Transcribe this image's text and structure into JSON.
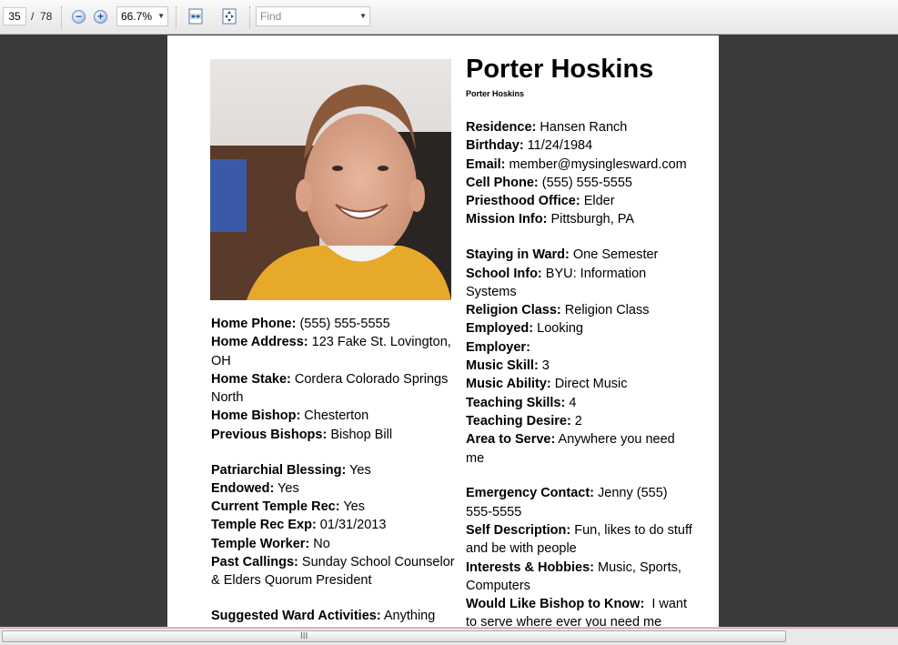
{
  "toolbar": {
    "page_number": "35",
    "page_total": "/  78",
    "zoom_out_icon": "zoom-out-icon",
    "zoom_in_icon": "zoom-in-icon",
    "zoom_level": "66.7%",
    "fit_width_icon": "fit-width-icon",
    "fit_page_icon": "fit-page-icon",
    "find_placeholder": "Find"
  },
  "profile": {
    "name": "Porter Hoskins",
    "name_caption": "Porter Hoskins",
    "photo_alt": "photo of Porter Hoskins",
    "left_fields": [
      {
        "label": "Home Phone:",
        "value": " (555) 555-5555"
      },
      {
        "label": "Home Address:",
        "value": " 123 Fake St. Lovington, OH"
      },
      {
        "label": "Home Stake:",
        "value": " Cordera Colorado Springs North"
      },
      {
        "label": "Home Bishop:",
        "value": " Chesterton"
      },
      {
        "label": "Previous Bishops:",
        "value": " Bishop Bill"
      },
      {
        "label": "Patriarchial Blessing:",
        "value": " Yes"
      },
      {
        "label": "Endowed:",
        "value": " Yes"
      },
      {
        "label": "Current Temple Rec:",
        "value": " Yes"
      },
      {
        "label": "Temple Rec Exp:",
        "value": " 01/31/2013"
      },
      {
        "label": "Temple Worker:",
        "value": " No"
      },
      {
        "label": "Past Callings:",
        "value": " Sunday School Counselor & Elders Quorum President"
      },
      {
        "label": "Suggested Ward Activities:",
        "value": " Anything"
      }
    ],
    "right_fields": [
      {
        "label": "Residence:",
        "value": " Hansen Ranch"
      },
      {
        "label": "Birthday:",
        "value": " 11/24/1984"
      },
      {
        "label": "Email:",
        "value": " member@mysinglesward.com"
      },
      {
        "label": "Cell Phone:",
        "value": " (555) 555-5555"
      },
      {
        "label": "Priesthood Office:",
        "value": " Elder"
      },
      {
        "label": "Mission Info:",
        "value": " Pittsburgh, PA"
      },
      {
        "label": "Staying in Ward:",
        "value": " One Semester"
      },
      {
        "label": "School Info:",
        "value": " BYU: Information Systems"
      },
      {
        "label": "Religion Class:",
        "value": " Religion Class"
      },
      {
        "label": "Employed:",
        "value": " Looking"
      },
      {
        "label": "Employer:",
        "value": ""
      },
      {
        "label": "Music Skill:",
        "value": " 3"
      },
      {
        "label": "Music Ability:",
        "value": " Direct Music"
      },
      {
        "label": "Teaching Skills:",
        "value": " 4"
      },
      {
        "label": "Teaching Desire:",
        "value": " 2"
      },
      {
        "label": "Area to Serve:",
        "value": " Anywhere you need me"
      },
      {
        "label": "Emergency Contact:",
        "value": " Jenny (555) 555-5555"
      },
      {
        "label": "Self Description:",
        "value": " Fun, likes to do stuff and be with people"
      },
      {
        "label": "Interests & Hobbies:",
        "value": " Music, Sports, Computers"
      },
      {
        "label": "Would Like Bishop to Know:",
        "value": "  I want to serve where ever you need me"
      }
    ]
  },
  "scrollbar": {
    "grip": "III"
  }
}
